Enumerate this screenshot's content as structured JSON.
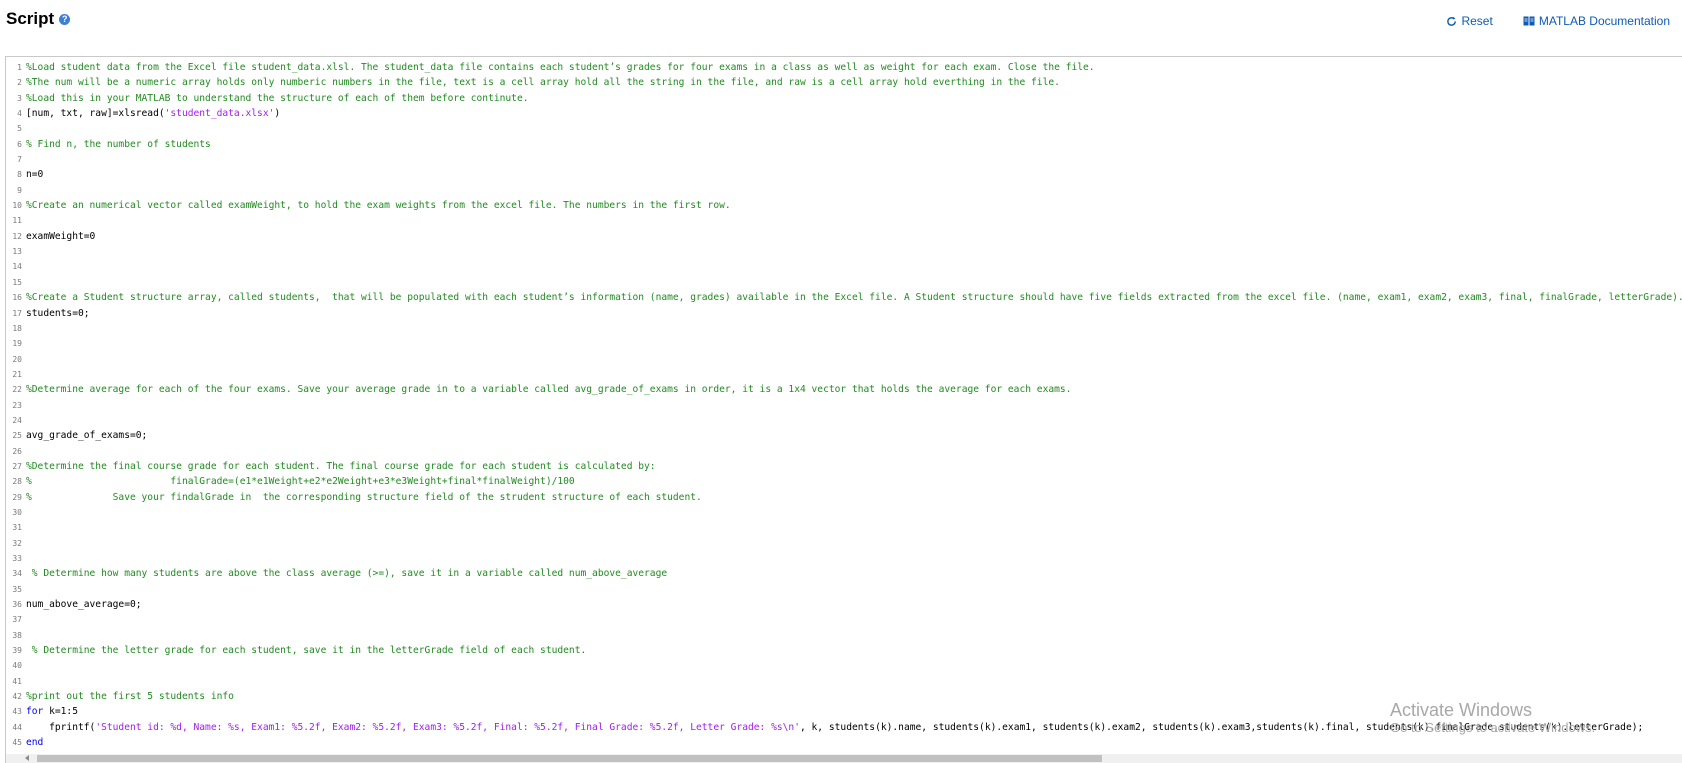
{
  "header": {
    "title": "Script",
    "help_icon": "?",
    "reset_label": "Reset",
    "doc_label": "MATLAB Documentation"
  },
  "colors": {
    "comment": "#228b22",
    "string": "#a020f0",
    "keyword": "#0000ff",
    "link": "#0d5bb5",
    "help_icon": "#3f7fd0"
  },
  "icons": {
    "help": "question-mark-circle-icon",
    "reset": "refresh-icon",
    "documentation": "book-icon"
  },
  "editor": {
    "lines": [
      {
        "n": "1",
        "segments": [
          {
            "t": "c",
            "text": "%Load student data from the Excel file student_data.xlsl. The student_data file contains each student’s grades for four exams in a class as well as weight for each exam. Close the file."
          }
        ]
      },
      {
        "n": "2",
        "segments": [
          {
            "t": "c",
            "text": "%The num will be a numeric array holds only numberic numbers in the file, text is a cell array hold all the string in the file, and raw is a cell array hold everthing in the file."
          }
        ]
      },
      {
        "n": "3",
        "segments": [
          {
            "t": "c",
            "text": "%Load this in your MATLAB to understand the structure of each of them before continute."
          }
        ]
      },
      {
        "n": "4",
        "segments": [
          {
            "t": "p",
            "text": "[num, txt, raw]=xlsread("
          },
          {
            "t": "s",
            "text": "'student_data.xlsx'"
          },
          {
            "t": "p",
            "text": ")"
          }
        ]
      },
      {
        "n": "5",
        "segments": []
      },
      {
        "n": "6",
        "segments": [
          {
            "t": "c",
            "text": "% Find n, the number of students"
          }
        ]
      },
      {
        "n": "7",
        "segments": []
      },
      {
        "n": "8",
        "segments": [
          {
            "t": "p",
            "text": "n=0"
          }
        ]
      },
      {
        "n": "9",
        "segments": []
      },
      {
        "n": "10",
        "segments": [
          {
            "t": "c",
            "text": "%Create an numerical vector called examWeight, to hold the exam weights from the excel file. The numbers in the first row."
          }
        ]
      },
      {
        "n": "11",
        "segments": []
      },
      {
        "n": "12",
        "segments": [
          {
            "t": "p",
            "text": "examWeight=0"
          }
        ]
      },
      {
        "n": "13",
        "segments": []
      },
      {
        "n": "14",
        "segments": []
      },
      {
        "n": "15",
        "segments": []
      },
      {
        "n": "16",
        "segments": [
          {
            "t": "c",
            "text": "%Create a Student structure array, called students,  that will be populated with each student’s information (name, grades) available in the Excel file. A Student structure should have five fields extracted from the excel file. (name, exam1, exam2, exam3, final, finalGrade, letterGrade)."
          }
        ]
      },
      {
        "n": "17",
        "segments": [
          {
            "t": "p",
            "text": "students=0;"
          }
        ]
      },
      {
        "n": "18",
        "segments": []
      },
      {
        "n": "19",
        "segments": []
      },
      {
        "n": "20",
        "segments": []
      },
      {
        "n": "21",
        "segments": []
      },
      {
        "n": "22",
        "segments": [
          {
            "t": "c",
            "text": "%Determine average for each of the four exams. Save your average grade in to a variable called avg_grade_of_exams in order, it is a 1x4 vector that holds the average for each exams."
          }
        ]
      },
      {
        "n": "23",
        "segments": []
      },
      {
        "n": "24",
        "segments": []
      },
      {
        "n": "25",
        "segments": [
          {
            "t": "p",
            "text": "avg_grade_of_exams=0;"
          }
        ]
      },
      {
        "n": "26",
        "segments": []
      },
      {
        "n": "27",
        "segments": [
          {
            "t": "c",
            "text": "%Determine the final course grade for each student. The final course grade for each student is calculated by:"
          }
        ]
      },
      {
        "n": "28",
        "segments": [
          {
            "t": "c",
            "text": "%                        finalGrade=(e1*e1Weight+e2*e2Weight+e3*e3Weight+final*finalWeight)/100"
          }
        ]
      },
      {
        "n": "29",
        "segments": [
          {
            "t": "c",
            "text": "%              Save your findalGrade in  the corresponding structure field of the strudent structure of each student."
          }
        ]
      },
      {
        "n": "30",
        "segments": []
      },
      {
        "n": "31",
        "segments": []
      },
      {
        "n": "32",
        "segments": []
      },
      {
        "n": "33",
        "segments": []
      },
      {
        "n": "34",
        "segments": [
          {
            "t": "c",
            "text": " % Determine how many students are above the class average (>=), save it in a variable called num_above_average"
          }
        ]
      },
      {
        "n": "35",
        "segments": []
      },
      {
        "n": "36",
        "segments": [
          {
            "t": "p",
            "text": "num_above_average=0;"
          }
        ]
      },
      {
        "n": "37",
        "segments": []
      },
      {
        "n": "38",
        "segments": []
      },
      {
        "n": "39",
        "segments": [
          {
            "t": "c",
            "text": " % Determine the letter grade for each student, save it in the letterGrade field of each student."
          }
        ]
      },
      {
        "n": "40",
        "segments": []
      },
      {
        "n": "41",
        "segments": []
      },
      {
        "n": "42",
        "segments": [
          {
            "t": "c",
            "text": "%print out the first 5 students info"
          }
        ]
      },
      {
        "n": "43",
        "segments": [
          {
            "t": "k",
            "text": "for"
          },
          {
            "t": "p",
            "text": " k=1:5"
          }
        ]
      },
      {
        "n": "44",
        "segments": [
          {
            "t": "p",
            "text": "    fprintf("
          },
          {
            "t": "s",
            "text": "'Student id: %d, Name: %s, Exam1: %5.2f, Exam2: %5.2f, Exam3: %5.2f, Final: %5.2f, Final Grade: %5.2f, Letter Grade: %s\\n'"
          },
          {
            "t": "p",
            "text": ", k, students(k).name, students(k).exam1, students(k).exam2, students(k).exam3,students(k).final, students(k).finalGrade,students(k).letterGrade);"
          }
        ]
      },
      {
        "n": "45",
        "segments": [
          {
            "t": "k",
            "text": "end"
          }
        ]
      }
    ]
  },
  "watermark": {
    "title": "Activate Windows",
    "subtitle": "Go to Settings to activate Windows."
  }
}
